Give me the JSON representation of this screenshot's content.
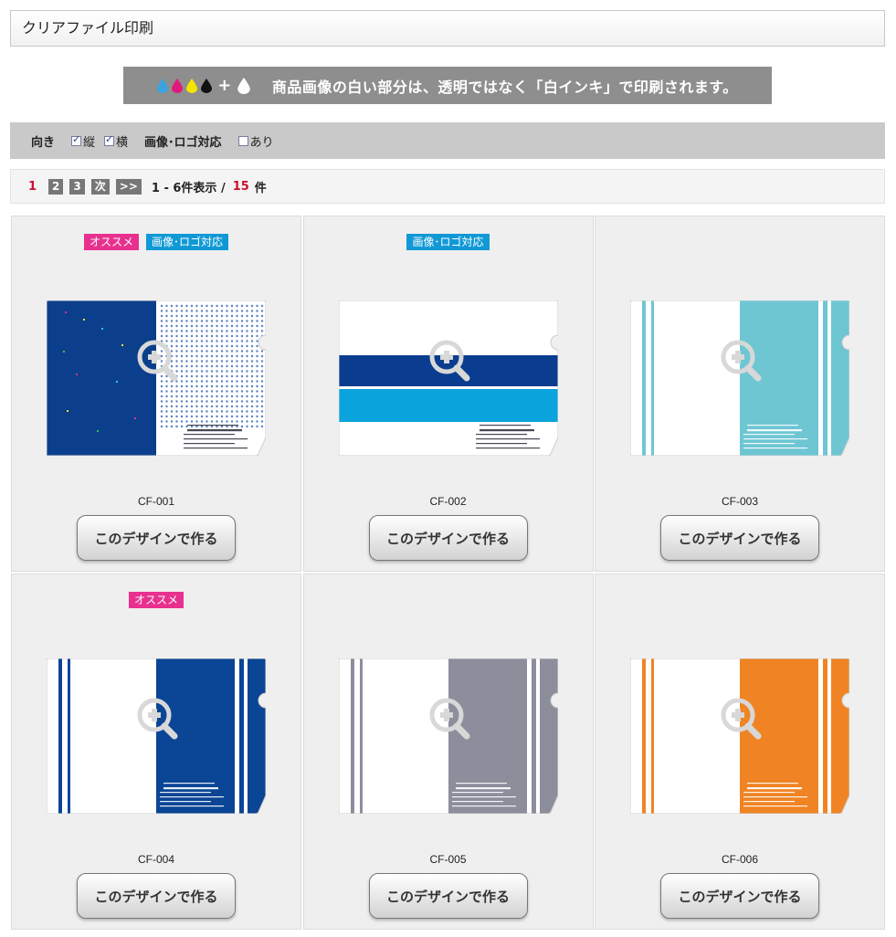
{
  "title": "クリアファイル印刷",
  "notice": {
    "plus": "+",
    "text": "商品画像の白い部分は、透明ではなく「白インキ」で印刷されます。",
    "ink_colors": [
      "#3aa3e0",
      "#e0197d",
      "#f5e400",
      "#111111"
    ],
    "white_ink_color": "#ffffff"
  },
  "filters": {
    "orientation_label": "向き",
    "portrait_label": "縦",
    "portrait_checked": true,
    "landscape_label": "横",
    "landscape_checked": true,
    "logo_label": "画像･ロゴ対応",
    "logo_option_label": "あり",
    "logo_option_checked": false
  },
  "pager": {
    "current": "1",
    "pages": [
      "2",
      "3"
    ],
    "next": "次",
    "last": ">>",
    "range_text": "1 - 6件表示 /",
    "total": "15",
    "unit": "件"
  },
  "badge_labels": {
    "recommended": "オススメ",
    "logo": "画像･ロゴ対応"
  },
  "button_label": "このデザインで作る",
  "products": [
    {
      "code": "CF-001",
      "recommended": true,
      "logo": true,
      "design": "dots",
      "color": "#0b3f8c"
    },
    {
      "code": "CF-002",
      "recommended": false,
      "logo": true,
      "design": "bands",
      "color": "#0a3d8f",
      "accent": "#0aa3dc"
    },
    {
      "code": "CF-003",
      "recommended": false,
      "logo": false,
      "design": "stripes",
      "color": "#6ec6d3"
    },
    {
      "code": "CF-004",
      "recommended": true,
      "logo": false,
      "design": "stripes",
      "color": "#0b4595"
    },
    {
      "code": "CF-005",
      "recommended": false,
      "logo": false,
      "design": "stripes",
      "color": "#8c8e9c"
    },
    {
      "code": "CF-006",
      "recommended": false,
      "logo": false,
      "design": "stripes",
      "color": "#f08424"
    }
  ]
}
